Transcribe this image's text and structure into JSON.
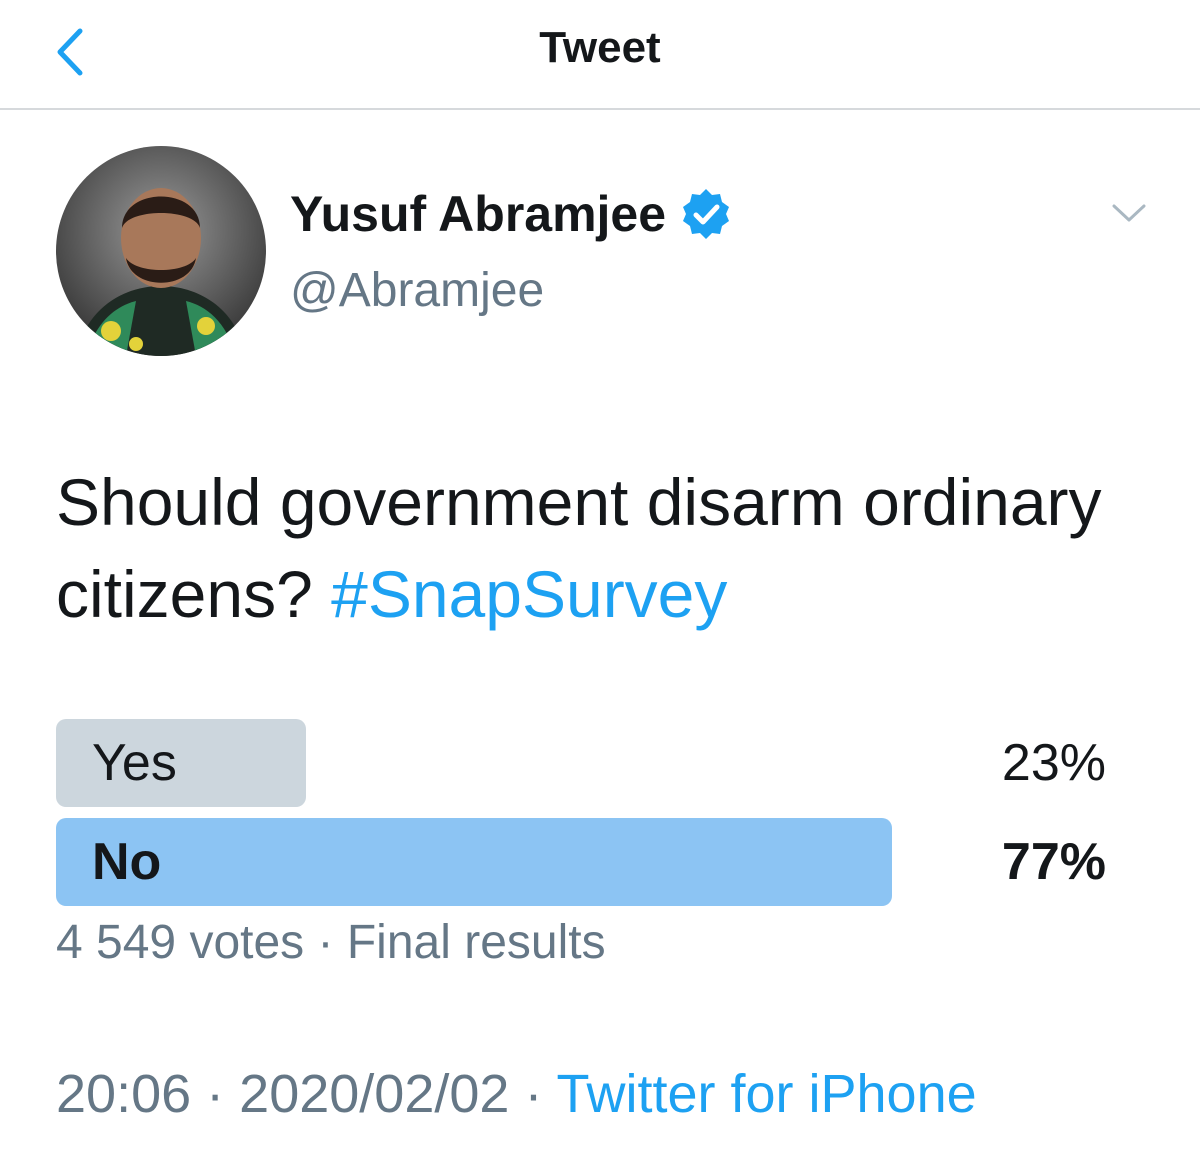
{
  "header": {
    "title": "Tweet",
    "back_icon": "chevron-left-icon"
  },
  "author": {
    "display_name": "Yusuf Abramjee",
    "handle": "@Abramjee",
    "verified": true
  },
  "tweet": {
    "text": "Should government disarm ordinary citizens?",
    "hashtag": "#SnapSurvey"
  },
  "poll": {
    "options": [
      {
        "label": "Yes",
        "percent_text": "23%",
        "percent": 23,
        "winner": false
      },
      {
        "label": "No",
        "percent_text": "77%",
        "percent": 77,
        "winner": true
      }
    ],
    "votes_text": "4 549 votes",
    "status_text": "Final results",
    "separator": "·"
  },
  "meta": {
    "time": "20:06",
    "date": "2020/02/02",
    "source": "Twitter for iPhone",
    "separator": "·"
  },
  "colors": {
    "accent": "#1da1f2",
    "poll_winner": "#8cc4f3",
    "poll_other": "#ccd6dd",
    "muted": "#657786"
  }
}
